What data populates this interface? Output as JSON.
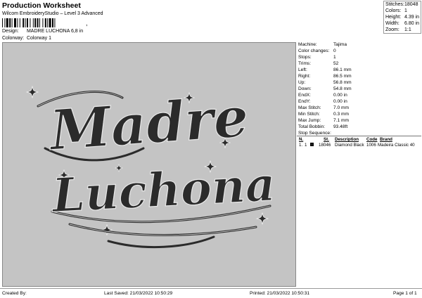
{
  "header": {
    "title": "Production Worksheet",
    "subtitle": "Wilcom EmbroideryStudio – Level 3 Advanced",
    "barcode_suffix": ",",
    "design_label": "Design:",
    "design_value": "MADRE LUCHONA 6,8 in",
    "colorway_label": "Colorway:",
    "colorway_value": "Colorway 1"
  },
  "stats": [
    {
      "label": "Stitches:",
      "value": "18048"
    },
    {
      "label": "Colors:",
      "value": "1"
    },
    {
      "label": "Height:",
      "value": "4.39 in"
    },
    {
      "label": "Width:",
      "value": "6.80 in"
    },
    {
      "label": "Zoom:",
      "value": "1:1"
    }
  ],
  "design": {
    "line1": "Madre",
    "line2": "Luchona",
    "background": "#c4c4c4",
    "thread_color": "#2b2b2b"
  },
  "info": [
    {
      "label": "Machine:",
      "value": "Tajima"
    },
    {
      "label": "Color changes:",
      "value": "0"
    },
    {
      "label": "Stops:",
      "value": "1"
    },
    {
      "label": "Trims:",
      "value": "52"
    },
    {
      "label": "Left:",
      "value": "86.1 mm"
    },
    {
      "label": "Right:",
      "value": "86.5 mm"
    },
    {
      "label": "Up:",
      "value": "56.8 mm"
    },
    {
      "label": "Down:",
      "value": "54.8 mm"
    },
    {
      "label": "EndX:",
      "value": "0.00 in"
    },
    {
      "label": "EndY:",
      "value": "0.00 in"
    },
    {
      "label": "Max Stitch:",
      "value": "7.0 mm"
    },
    {
      "label": "Min Stitch:",
      "value": "0.3 mm"
    },
    {
      "label": "Max Jump:",
      "value": "7.1 mm"
    },
    {
      "label": "Total Bobbin:",
      "value": "93.48ft"
    }
  ],
  "sequence": {
    "label": "Stop Sequence:",
    "headers": {
      "n": "N.",
      "st": "St.",
      "description": "Description",
      "code": "Code",
      "brand": "Brand"
    },
    "row": {
      "stop": "1.",
      "color": "1",
      "stitches": "18046",
      "description": "Diamond Black",
      "code": "1006",
      "brand": "Madeira Classic 40"
    }
  },
  "footer": {
    "created_by": "Created By:",
    "last_saved": "Last Saved: 21/03/2022 10:50:29",
    "printed": "Printed: 21/03/2022 10:50:31",
    "page": "Page 1 of 1"
  }
}
